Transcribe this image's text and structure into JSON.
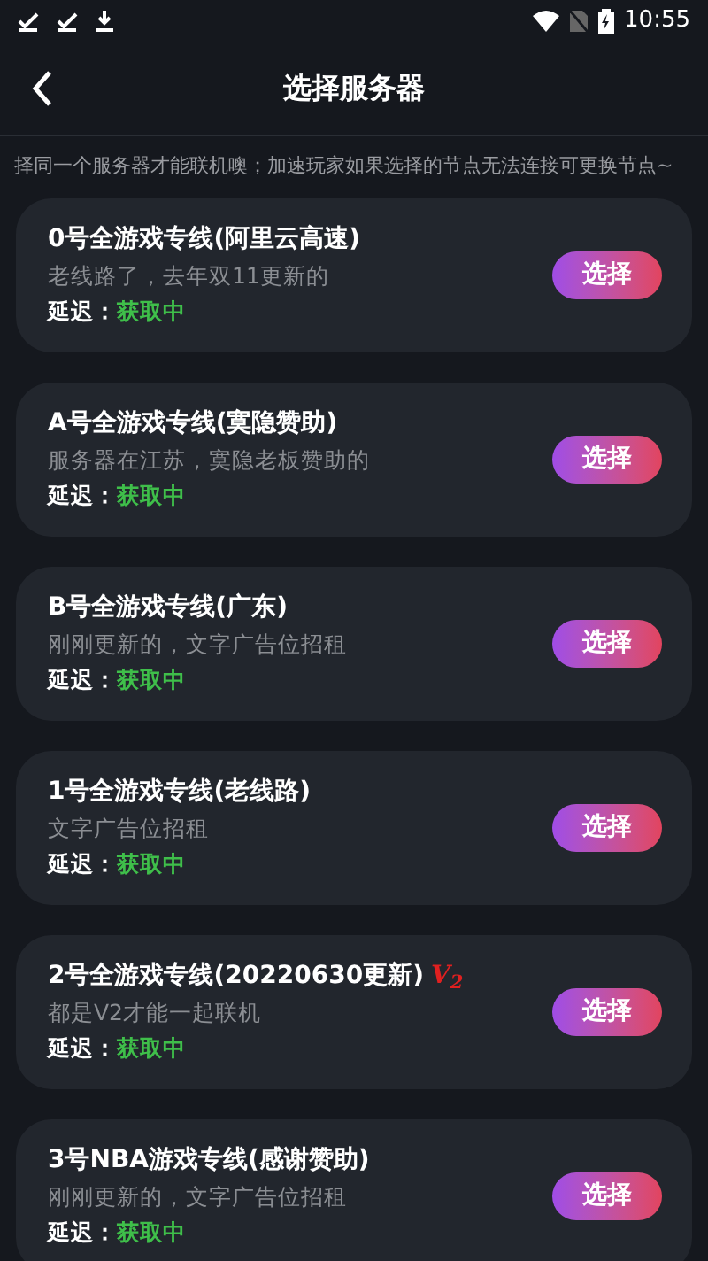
{
  "status_bar": {
    "time": "10:55"
  },
  "header": {
    "title": "选择服务器"
  },
  "notice": "择同一个服务器才能联机噢；加速玩家如果选择的节点无法连接可更换节点~",
  "servers": [
    {
      "name": "0号全游戏专线(阿里云高速)",
      "description": "老线路了，去年双11更新的",
      "latency_label": "延迟：",
      "latency": "获取中",
      "button": "选择"
    },
    {
      "name": "A号全游戏专线(寞隐赞助)",
      "description": "服务器在江苏，寞隐老板赞助的",
      "latency_label": "延迟：",
      "latency": "获取中",
      "button": "选择"
    },
    {
      "name": "B号全游戏专线(广东)",
      "description": "刚刚更新的，文字广告位招租",
      "latency_label": "延迟：",
      "latency": "获取中",
      "button": "选择"
    },
    {
      "name": "1号全游戏专线(老线路)",
      "description": "文字广告位招租",
      "latency_label": "延迟：",
      "latency": "获取中",
      "button": "选择"
    },
    {
      "name": "2号全游戏专线(20220630更新)",
      "badge": "V$_{2}$",
      "description": "都是V2才能一起联机",
      "latency_label": "延迟：",
      "latency": "获取中",
      "button": "选择"
    },
    {
      "name": "3号NBA游戏专线(感谢赞助)",
      "description": "刚刚更新的，文字广告位招租",
      "latency_label": "延迟：",
      "latency": "获取中",
      "button": "选择"
    }
  ]
}
